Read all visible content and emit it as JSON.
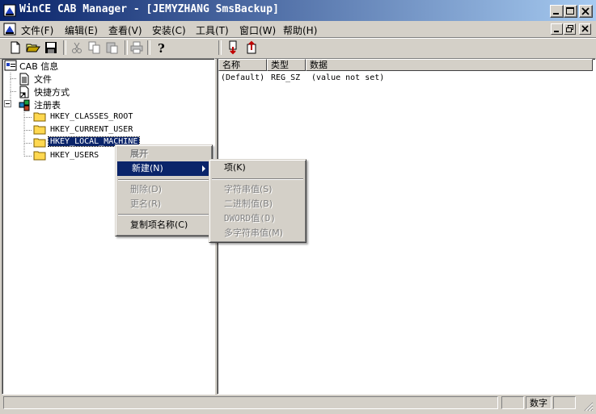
{
  "window": {
    "title": "WinCE CAB Manager - [JEMYZHANG SmsBackup]",
    "title_bar_color": "#0a246a"
  },
  "menubar": {
    "items": [
      "文件(F)",
      "编辑(E)",
      "查看(V)",
      "安装(C)",
      "工具(T)",
      "窗口(W)",
      "帮助(H)"
    ]
  },
  "toolbar": {
    "icons": [
      "new-file-icon",
      "open-folder-icon",
      "save-icon",
      "cut-icon",
      "copy-icon",
      "paste-icon",
      "print-icon",
      "help-icon",
      "import-icon",
      "export-icon"
    ]
  },
  "tree": {
    "root": "CAB 信息",
    "items": [
      "文件",
      "快捷方式",
      "注册表"
    ],
    "registry_keys": [
      "HKEY_CLASSES_ROOT",
      "HKEY_CURRENT_USER",
      "HKEY_LOCAL_MACHINE",
      "HKEY_USERS"
    ],
    "selected": "HKEY_LOCAL_MACHINE"
  },
  "list": {
    "columns": [
      "名称",
      "类型",
      "数据"
    ],
    "rows": [
      {
        "name": "(Default)",
        "type": "REG_SZ",
        "data": "(value not set)"
      }
    ]
  },
  "context_menu": {
    "items": [
      {
        "label": "展开",
        "state": "disabled-bold"
      },
      {
        "label": "新建(N)",
        "state": "highlighted"
      },
      {
        "label": "删除(D)",
        "state": "disabled"
      },
      {
        "label": "更名(R)",
        "state": "disabled"
      },
      {
        "label": "复制项名称(C)",
        "state": "enabled"
      }
    ]
  },
  "submenu": {
    "items": [
      {
        "label": "项(K)",
        "state": "enabled"
      },
      {
        "label": "字符串值(S)",
        "state": "disabled"
      },
      {
        "label": "二进制值(B)",
        "state": "disabled"
      },
      {
        "label": "DWORD值(D)",
        "state": "disabled"
      },
      {
        "label": "多字符串值(M)",
        "state": "disabled"
      }
    ]
  },
  "statusbar": {
    "num_lock": "数字"
  }
}
